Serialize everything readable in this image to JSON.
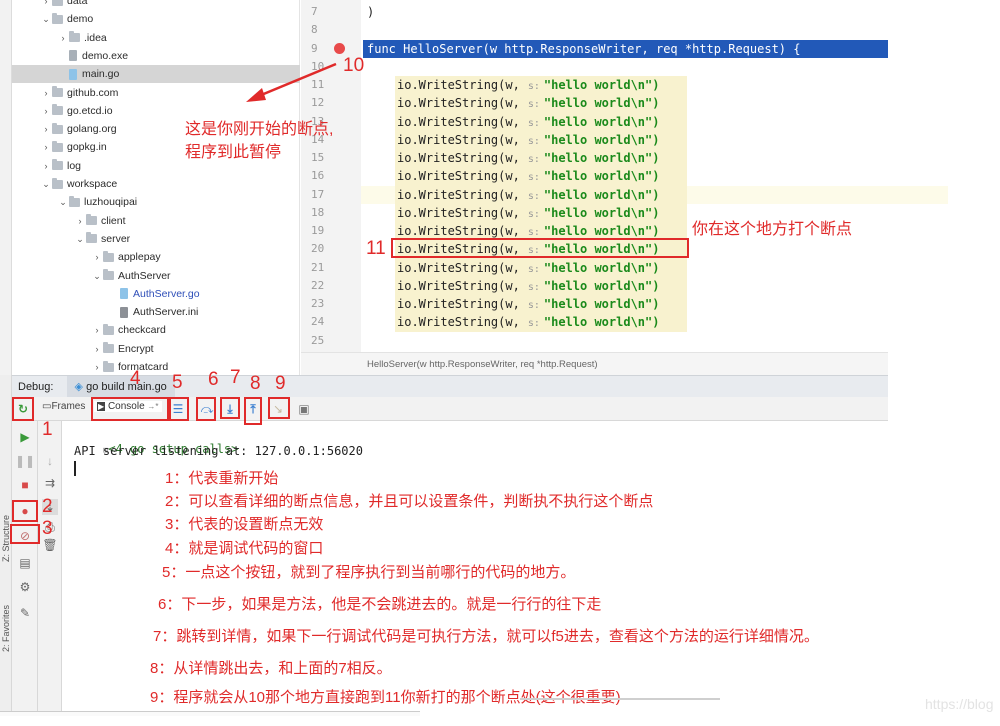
{
  "project_tree": {
    "items": [
      {
        "label": "data",
        "type": "folder",
        "expanded": false,
        "depth": 1
      },
      {
        "label": "demo",
        "type": "folder",
        "expanded": true,
        "depth": 1
      },
      {
        "label": ".idea",
        "type": "folder",
        "expanded": false,
        "depth": 2
      },
      {
        "label": "demo.exe",
        "type": "file-exe",
        "depth": 2
      },
      {
        "label": "main.go",
        "type": "file-go",
        "depth": 2,
        "selected": true
      },
      {
        "label": "github.com",
        "type": "folder",
        "expanded": false,
        "depth": 1
      },
      {
        "label": "go.etcd.io",
        "type": "folder",
        "expanded": false,
        "depth": 1
      },
      {
        "label": "golang.org",
        "type": "folder",
        "expanded": false,
        "depth": 1
      },
      {
        "label": "gopkg.in",
        "type": "folder",
        "expanded": false,
        "depth": 1
      },
      {
        "label": "log",
        "type": "folder",
        "expanded": false,
        "depth": 1
      },
      {
        "label": "workspace",
        "type": "folder",
        "expanded": true,
        "depth": 1
      },
      {
        "label": "luzhouqipai",
        "type": "folder",
        "expanded": true,
        "depth": 2
      },
      {
        "label": "client",
        "type": "folder",
        "expanded": false,
        "depth": 3
      },
      {
        "label": "server",
        "type": "folder",
        "expanded": true,
        "depth": 3
      },
      {
        "label": "applepay",
        "type": "folder",
        "expanded": false,
        "depth": 4
      },
      {
        "label": "AuthServer",
        "type": "folder",
        "expanded": true,
        "depth": 4
      },
      {
        "label": "AuthServer.go",
        "type": "file-go",
        "depth": 5,
        "blue": true
      },
      {
        "label": "AuthServer.ini",
        "type": "file-ini",
        "depth": 5
      },
      {
        "label": "checkcard",
        "type": "folder",
        "expanded": false,
        "depth": 4
      },
      {
        "label": "Encrypt",
        "type": "folder",
        "expanded": false,
        "depth": 4
      },
      {
        "label": "formatcard",
        "type": "folder",
        "expanded": false,
        "depth": 4
      }
    ]
  },
  "editor": {
    "lines": [
      {
        "num": "7",
        "code": ")"
      },
      {
        "num": "8",
        "code": ""
      },
      {
        "num": "9",
        "code": "func HelloServer(w http.ResponseWriter, req *http.Request) {",
        "breakpoint": true,
        "highlighted": true
      },
      {
        "num": "10",
        "code": ""
      },
      {
        "num": "11",
        "call": "io.WriteString(w,",
        "hint": "s:",
        "str": "\"hello world\\n\")"
      },
      {
        "num": "12",
        "call": "io.WriteString(w,",
        "hint": "s:",
        "str": "\"hello world\\n\")"
      },
      {
        "num": "13",
        "call": "io.WriteString(w,",
        "hint": "s:",
        "str": "\"hello world\\n\")"
      },
      {
        "num": "14",
        "call": "io.WriteString(w,",
        "hint": "s:",
        "str": "\"hello world\\n\")"
      },
      {
        "num": "15",
        "call": "io.WriteString(w,",
        "hint": "s:",
        "str": "\"hello world\\n\")"
      },
      {
        "num": "16",
        "call": "io.WriteString(w,",
        "hint": "s:",
        "str": "\"hello world\\n\")"
      },
      {
        "num": "17",
        "call": "io.WriteString(w,",
        "hint": "s:",
        "str": "\"hello world\\n\")",
        "current": true
      },
      {
        "num": "18",
        "call": "io.WriteString(w,",
        "hint": "s:",
        "str": "\"hello world\\n\")"
      },
      {
        "num": "19",
        "call": "io.WriteString(w,",
        "hint": "s:",
        "str": "\"hello world\\n\")"
      },
      {
        "num": "20",
        "call": "io.WriteString(w,",
        "hint": "s:",
        "str": "\"hello world\\n\")",
        "boxed": true
      },
      {
        "num": "21",
        "call": "io.WriteString(w,",
        "hint": "s:",
        "str": "\"hello world\\n\")"
      },
      {
        "num": "22",
        "call": "io.WriteString(w,",
        "hint": "s:",
        "str": "\"hello world\\n\")"
      },
      {
        "num": "23",
        "call": "io.WriteString(w,",
        "hint": "s:",
        "str": "\"hello world\\n\")"
      },
      {
        "num": "24",
        "call": "io.WriteString(w,",
        "hint": "s:",
        "str": "\"hello world\\n\")"
      },
      {
        "num": "25",
        "code": ""
      }
    ],
    "breadcrumb": "HelloServer(w http.ResponseWriter, req *http.Request)"
  },
  "debug": {
    "label": "Debug:",
    "run_tab": "go build main.go",
    "toolbar": {
      "frames_label": "Frames",
      "console_label": "Console",
      "console_suffix": "→*"
    },
    "console_lines": [
      "<4 go setup calls>",
      "API server listening at: 127.0.0.1:56020"
    ],
    "side_labels": {
      "structure": "Z: Structure",
      "favorites": "2: Favorites"
    }
  },
  "annotations": {
    "callout_numbers": [
      "1",
      "2",
      "3",
      "4",
      "5",
      "6",
      "7",
      "8",
      "9",
      "10",
      "11"
    ],
    "initial_breakpoint_note": [
      "这是你刚开始的断点,",
      "程序到此暂停"
    ],
    "new_breakpoint_note": "你在这个地方打个断点",
    "legend": [
      "1：代表重新开始",
      "2：可以查看详细的断点信息，并且可以设置条件，判断执不执行这个断点",
      "3：代表的设置断点无效",
      "4：就是调试代码的窗口",
      "5：一点这个按钮，就到了程序执行到当前哪行的代码的地方。",
      "6：下一步，如果是方法，他是不会跳进去的。就是一行行的往下走",
      "7：跳转到详情，如果下一行调试代码是可执行方法，就可以f5进去，查看这个方法的运行详细情况。",
      "8：从详情跳出去，和上面的7相反。",
      "9：程序就会从10那个地方直接跑到11你新打的那个断点处(这个很重要)"
    ],
    "watermark": "https://blog"
  },
  "colors": {
    "annotation_red": "#e02a2a",
    "selection_blue": "#2259b8",
    "string_green": "#1b8a1b",
    "breakpoint_red": "#e84a4a"
  }
}
